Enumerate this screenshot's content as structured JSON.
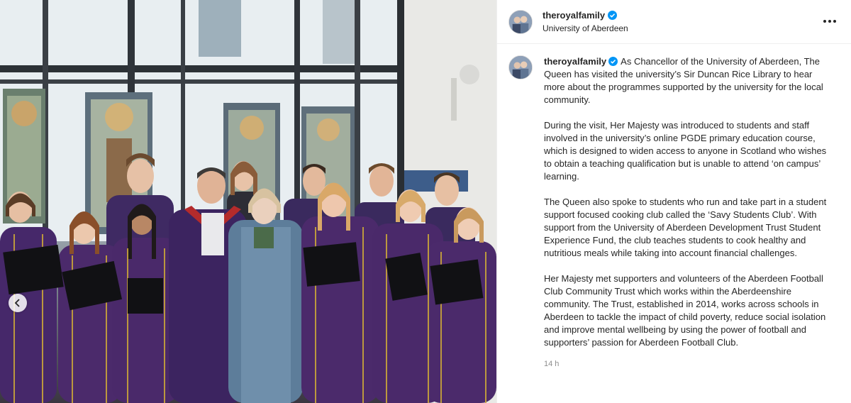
{
  "post": {
    "username": "theroyalfamily",
    "location": "University of Aberdeen",
    "verified_icon": "verified-badge-icon",
    "more_icon": "more-options-icon",
    "timestamp": "14 h",
    "caption_first": "As Chancellor of the University of Aberdeen, The Queen has visited the university’s Sir Duncan Rice Library to hear more about the programmes supported by the university for the local community.",
    "caption_paragraphs": [
      "During the visit, Her Majesty was introduced to students and staff involved in the university’s online PGDE primary education course, which is designed to widen access to anyone in Scotland who wishes to obtain a teaching qualification but is unable to attend ‘on campus’ learning.",
      "The Queen also spoke to students who run and take part in a student support focused cooking club called the ‘Savy Students Club’. With support from the University of Aberdeen Development Trust Student Experience Fund, the club teaches students to cook healthy and nutritious meals while taking into account financial challenges.",
      "Her Majesty met supporters and volunteers of the Aberdeen Football Club Community Trust which works within the Aberdeenshire community. The Trust, established in 2014, works across schools in Aberdeen to tackle the impact of child poverty, reduce social isolation and improve mental wellbeing by using the power of football and supporters’ passion for Aberdeen Football Club."
    ]
  },
  "media": {
    "prev_icon": "chevron-left-icon"
  },
  "colors": {
    "verified": "#0095f6",
    "secondary_text": "#8e8e8e",
    "gown_purple": "#4b2a6b"
  }
}
